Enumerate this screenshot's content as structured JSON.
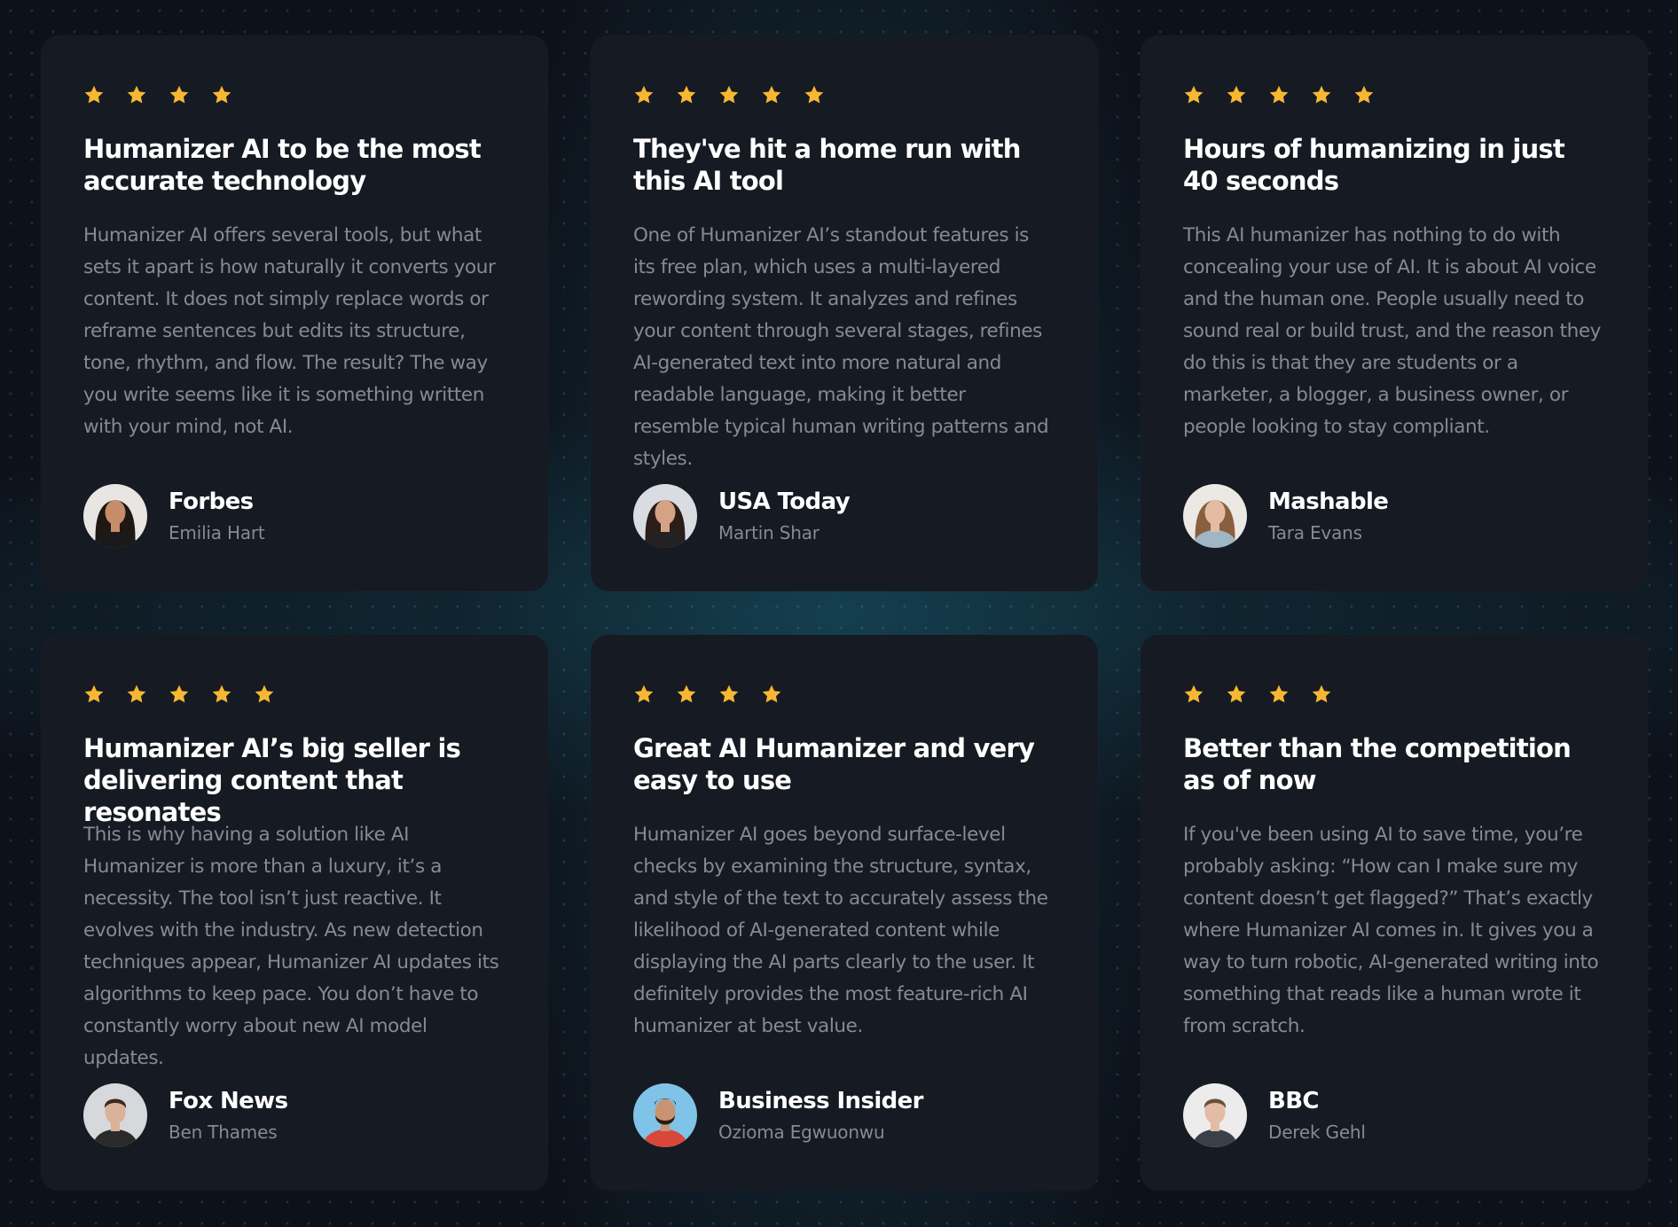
{
  "accent_colors": {
    "star": "#f7b733",
    "card_bg": "#161a22",
    "title": "#ffffff",
    "body_text": "#858a94"
  },
  "testimonials": [
    {
      "rating": 4,
      "title": "Humanizer AI to be the most accurate technology",
      "body": "Humanizer AI offers several tools, but what sets it apart is how naturally it converts your content. It does not simply replace words or reframe sentences but edits its structure, tone, rhythm, and flow. The result? The way you write seems like it is something written with your mind, not AI.",
      "outlet": "Forbes",
      "person": "Emilia Hart",
      "avatar": {
        "icon": "avatar-woman-dark-hair",
        "bg": "#e9e5e2",
        "hair": "#1f1712",
        "skin": "#c68d6b",
        "shirt": "#1a1a1a"
      }
    },
    {
      "rating": 5,
      "title": "They've hit a home run with this AI tool",
      "body": "One of Humanizer AI’s standout features is its free plan, which uses a multi-layered rewording system. It analyzes and refines your content through several stages, refines AI-generated text into more natural and readable language, making it better resemble typical human writing patterns and styles.",
      "outlet": "USA Today",
      "person": "Martin Shar",
      "avatar": {
        "icon": "avatar-woman-dark-hair",
        "bg": "#d9dde2",
        "hair": "#2b1d17",
        "skin": "#d6a285",
        "shirt": "#222222"
      }
    },
    {
      "rating": 5,
      "title": "Hours of humanizing in just 40 seconds",
      "body": "This AI humanizer has nothing to do with concealing your use of AI. It is about AI voice and the human one. People usually need to sound real or build trust, and the reason they do this is that they are students or a marketer, a blogger, a business owner, or people looking to stay compliant.",
      "outlet": "Mashable",
      "person": "Tara Evans",
      "avatar": {
        "icon": "avatar-woman-light-hair",
        "bg": "#ece8e4",
        "hair": "#8a5f40",
        "skin": "#e4bca2",
        "shirt": "#9fb6c4"
      }
    },
    {
      "rating": 5,
      "title": "Humanizer AI’s big seller is delivering content that resonates",
      "body": "This is why having a solution like AI Humanizer is more than a luxury, it’s a necessity. The tool isn’t just reactive. It evolves with the industry. As new detection techniques appear, Humanizer AI updates its algorithms to keep pace. You don’t have to constantly worry about new AI model updates.",
      "outlet": "Fox News",
      "person": "Ben Thames",
      "avatar": {
        "icon": "avatar-man",
        "bg": "#d6d8dc",
        "hair": "#3a2a20",
        "skin": "#d9b299",
        "shirt": "#2a2a2a"
      }
    },
    {
      "rating": 4,
      "title": "Great AI Humanizer and very easy to use",
      "body": "Humanizer AI goes beyond surface-level checks by examining the structure, syntax, and style of the text to accurately assess the likelihood of AI-generated content while displaying the AI parts clearly to the user. It definitely provides the most feature-rich AI humanizer at best value.",
      "outlet": "Business Insider",
      "person": "Ozioma Egwuonwu",
      "avatar": {
        "icon": "avatar-man-beard",
        "bg": "#7fc3e8",
        "hair": "#2a1c14",
        "skin": "#c79473",
        "shirt": "#d9473b"
      }
    },
    {
      "rating": 4,
      "title": "Better than the competition as of now",
      "body": "If you've been using AI to save time, you’re probably asking: “How can I make sure my content doesn’t get flagged?” That’s exactly where Humanizer AI comes in. It gives you a way to turn robotic, AI-generated writing into something that reads like a human wrote it from scratch.",
      "outlet": "BBC",
      "person": "Derek Gehl",
      "avatar": {
        "icon": "avatar-man",
        "bg": "#ececec",
        "hair": "#6b5038",
        "skin": "#e2bca4",
        "shirt": "#3a4048"
      }
    }
  ]
}
